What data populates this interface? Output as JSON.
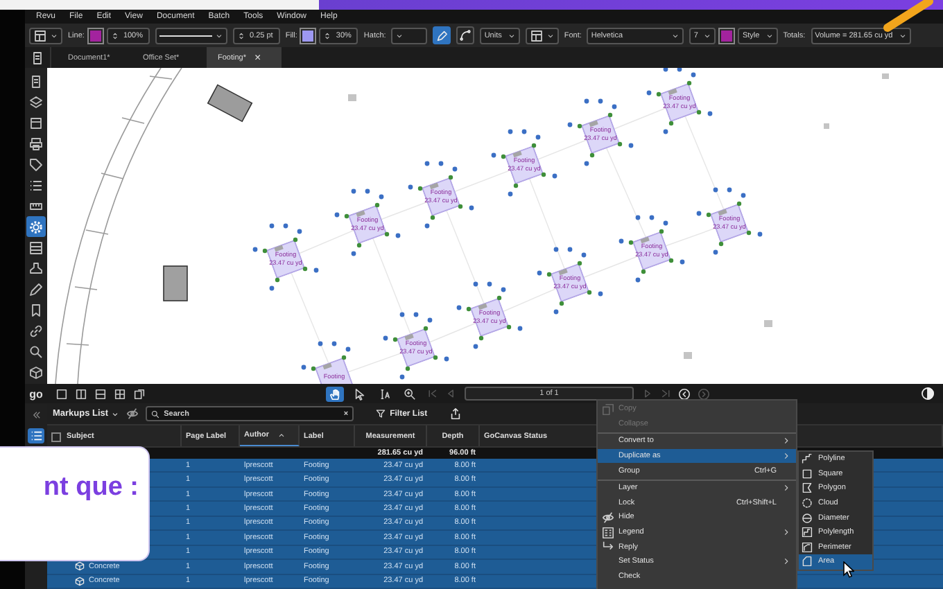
{
  "menu_bar": [
    "Revu",
    "File",
    "Edit",
    "View",
    "Document",
    "Batch",
    "Tools",
    "Window",
    "Help"
  ],
  "toolbar": [
    {
      "kind": "icon_dropdown"
    },
    {
      "kind": "label",
      "text": "Line:"
    },
    {
      "kind": "swatch",
      "color": "#a3239e"
    },
    {
      "kind": "spinner",
      "value": "100%"
    },
    {
      "kind": "line_dropdown"
    },
    {
      "kind": "spinner",
      "value": "0.25 pt"
    },
    {
      "kind": "label",
      "text": "Fill:"
    },
    {
      "kind": "swatch",
      "color": "#9d98f2"
    },
    {
      "kind": "spinner",
      "value": "30%"
    },
    {
      "kind": "label",
      "text": "Hatch:"
    },
    {
      "kind": "dropdown"
    },
    {
      "kind": "icon_button",
      "selected": true
    },
    {
      "kind": "icon_button",
      "selected": false
    },
    {
      "kind": "dropdown",
      "value": "Units"
    },
    {
      "kind": "icon_dropdown"
    },
    {
      "kind": "label",
      "text": "Font:"
    },
    {
      "kind": "font_dropdown",
      "value": "Helvetica"
    },
    {
      "kind": "dropdown",
      "value": "7"
    },
    {
      "kind": "swatch",
      "color": "#a3239e"
    },
    {
      "kind": "dropdown",
      "value": "Style"
    },
    {
      "kind": "label",
      "text": "Totals:"
    },
    {
      "kind": "dropdown",
      "value": "Volume = 281.65 cu yd"
    }
  ],
  "tabs": [
    {
      "label": "Document1*",
      "selected": false
    },
    {
      "label": "Office Set*",
      "selected": false
    },
    {
      "label": "Footing*",
      "selected": true,
      "close": "×"
    }
  ],
  "sidebar": {
    "tools": [
      {
        "selected": false
      },
      {
        "selected": false
      },
      {
        "selected": false
      },
      {
        "selected": false
      },
      {
        "selected": false
      },
      {
        "selected": false
      },
      {
        "selected": false
      },
      {
        "selected": true
      },
      {
        "selected": false
      },
      {
        "selected": false
      },
      {
        "selected": false
      },
      {
        "selected": false
      },
      {
        "selected": false
      },
      {
        "selected": false
      },
      {
        "selected": false
      }
    ]
  },
  "canvas": {
    "footings": [
      {
        "label": "Footing",
        "value": "23.47 cu yd"
      },
      {
        "label": "Footing",
        "value": "23.47 cu yd"
      },
      {
        "label": "Footing",
        "value": "23.47 cu yd"
      },
      {
        "label": "Footing",
        "value": "23.47 cu yd"
      },
      {
        "label": "Footing",
        "value": "23.47 cu yd"
      },
      {
        "label": "Footing",
        "value": "23.47 cu yd"
      },
      {
        "label": "Footing",
        "value": "23.47 cu yd"
      },
      {
        "label": "Footing",
        "value": "23.47 cu yd"
      },
      {
        "label": "Footing",
        "value": "23.47 cu yd"
      },
      {
        "label": "Footing",
        "value": "23.47 cu yd"
      },
      {
        "label": "Footing",
        "value": "23.47 cu yd"
      },
      {
        "label": "Footing"
      }
    ]
  },
  "nav_bar": {
    "logo": "go",
    "tools": [
      {
        "selected": true
      },
      {
        "selected": false
      },
      {
        "selected": false
      },
      {
        "selected": false
      }
    ],
    "page": "1 of 1"
  },
  "markups": {
    "side_tabs": [
      {
        "selected": true
      }
    ],
    "title": "Markups List",
    "search_placeholder": "Search",
    "clear": "×",
    "filter": "Filter List",
    "header_checkbox": {
      "checked": false
    },
    "columns": [
      {
        "label": "Subject",
        "sorted": false
      },
      {
        "label": "Page Label",
        "sorted": false
      },
      {
        "label": "Author",
        "sorted": true
      },
      {
        "label": "Label",
        "sorted": false
      },
      {
        "label": "Measurement",
        "sorted": false
      },
      {
        "label": "Depth",
        "sorted": false
      },
      {
        "label": "GoCanvas Status",
        "sorted": false
      }
    ],
    "totals": {
      "measurement": "281.65 cu yd",
      "depth": "96.00 ft"
    },
    "rows": [
      {
        "page_label": "1",
        "author": "lprescott",
        "label": "Footing",
        "measurement": "23.47 cu yd",
        "depth": "8.00 ft",
        "selected": true
      },
      {
        "page_label": "1",
        "author": "lprescott",
        "label": "Footing",
        "measurement": "23.47 cu yd",
        "depth": "8.00 ft",
        "selected": true
      },
      {
        "page_label": "1",
        "author": "lprescott",
        "label": "Footing",
        "measurement": "23.47 cu yd",
        "depth": "8.00 ft",
        "selected": true
      },
      {
        "page_label": "1",
        "author": "lprescott",
        "label": "Footing",
        "measurement": "23.47 cu yd",
        "depth": "8.00 ft",
        "selected": true
      },
      {
        "page_label": "1",
        "author": "lprescott",
        "label": "Footing",
        "measurement": "23.47 cu yd",
        "depth": "8.00 ft",
        "selected": true
      },
      {
        "page_label": "1",
        "author": "lprescott",
        "label": "Footing",
        "measurement": "23.47 cu yd",
        "depth": "8.00 ft",
        "selected": true
      },
      {
        "page_label": "1",
        "author": "lprescott",
        "label": "Footing",
        "measurement": "23.47 cu yd",
        "depth": "8.00 ft",
        "selected": true
      },
      {
        "subject": "Concrete",
        "page_label": "1",
        "author": "lprescott",
        "label": "Footing",
        "measurement": "23.47 cu yd",
        "depth": "8.00 ft",
        "selected": true
      },
      {
        "subject": "Concrete",
        "page_label": "1",
        "author": "lprescott",
        "label": "Footing",
        "measurement": "23.47 cu yd",
        "depth": "8.00 ft",
        "selected": true
      }
    ]
  },
  "context_menu": {
    "items": [
      {
        "label": "Copy",
        "disabled": true,
        "selected": false,
        "submenu": false,
        "separator_before": false
      },
      {
        "label": "Collapse",
        "disabled": true,
        "selected": false,
        "submenu": false,
        "separator_before": false
      },
      {
        "label": "Convert to",
        "disabled": false,
        "selected": false,
        "submenu": true,
        "separator_before": true
      },
      {
        "label": "Duplicate as",
        "disabled": false,
        "selected": true,
        "submenu": true,
        "separator_before": false
      },
      {
        "label": "Group",
        "shortcut": "Ctrl+G",
        "disabled": false,
        "selected": false,
        "submenu": false,
        "separator_before": false
      },
      {
        "label": "Layer",
        "disabled": false,
        "selected": false,
        "submenu": true,
        "separator_before": true
      },
      {
        "label": "Lock",
        "shortcut": "Ctrl+Shift+L",
        "disabled": false,
        "selected": false,
        "submenu": false,
        "separator_before": false
      },
      {
        "label": "Hide",
        "disabled": false,
        "selected": false,
        "submenu": false,
        "separator_before": false
      },
      {
        "label": "Legend",
        "disabled": false,
        "selected": false,
        "submenu": true,
        "separator_before": false
      },
      {
        "label": "Reply",
        "disabled": false,
        "selected": false,
        "submenu": false,
        "separator_before": false
      },
      {
        "label": "Set Status",
        "disabled": false,
        "selected": false,
        "submenu": true,
        "separator_before": false
      },
      {
        "label": "Check",
        "disabled": false,
        "selected": false,
        "submenu": false,
        "separator_before": false
      }
    ],
    "submenu": [
      {
        "label": "Polyline",
        "selected": false
      },
      {
        "label": "Square",
        "selected": false
      },
      {
        "label": "Polygon",
        "selected": false
      },
      {
        "label": "Cloud",
        "selected": false
      },
      {
        "label": "Diameter",
        "selected": false
      },
      {
        "label": "Polylength",
        "selected": false
      },
      {
        "label": "Perimeter",
        "selected": false
      },
      {
        "label": "Area",
        "selected": true
      }
    ]
  },
  "overlay": {
    "callout": "nt que :"
  }
}
